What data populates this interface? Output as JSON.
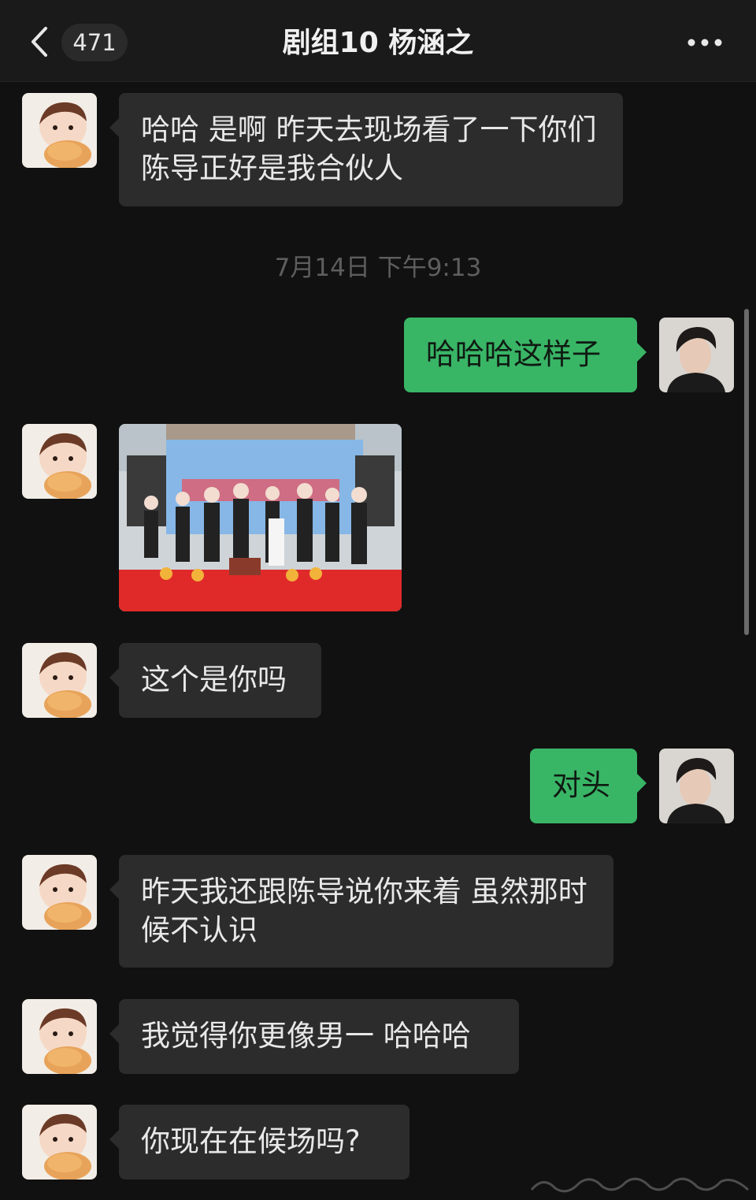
{
  "header": {
    "back_icon": "chevron-left-icon",
    "unread_count": "471",
    "title": "剧组10 杨涵之",
    "more_icon": "ellipsis-icon"
  },
  "colors": {
    "background": "#111111",
    "header": "#1a1a1a",
    "incoming_bubble": "#2c2c2c",
    "outgoing_bubble": "#39b566",
    "timestamp_text": "#5e5e5e"
  },
  "timestamp": "7月14日 下午9:13",
  "messages": [
    {
      "direction": "incoming",
      "type": "text",
      "text": "哈哈 是啊 昨天去现场看了一下你们 陈导正好是我合伙人"
    },
    {
      "direction": "outgoing",
      "type": "text",
      "text": "哈哈哈这样子"
    },
    {
      "direction": "incoming",
      "type": "image",
      "description_icon": "photo-icon"
    },
    {
      "direction": "incoming",
      "type": "text",
      "text": "这个是你吗"
    },
    {
      "direction": "outgoing",
      "type": "text",
      "text": "对头"
    },
    {
      "direction": "incoming",
      "type": "text",
      "text": "昨天我还跟陈导说你来着 虽然那时候不认识"
    },
    {
      "direction": "incoming",
      "type": "text",
      "text": "我觉得你更像男一 哈哈哈"
    },
    {
      "direction": "incoming",
      "type": "text",
      "text": "你现在在候场吗?"
    }
  ]
}
